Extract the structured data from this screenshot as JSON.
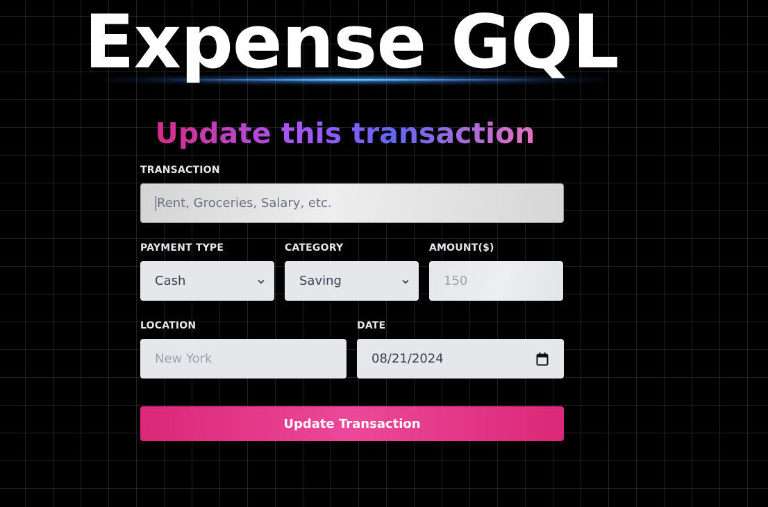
{
  "app": {
    "title": "Expense GQL"
  },
  "form": {
    "heading": "Update this transaction",
    "transaction": {
      "label": "TRANSACTION",
      "placeholder": "Rent, Groceries, Salary, etc.",
      "value": ""
    },
    "payment_type": {
      "label": "PAYMENT TYPE",
      "selected": "Cash"
    },
    "category": {
      "label": "CATEGORY",
      "selected": "Saving"
    },
    "amount": {
      "label": "AMOUNT($)",
      "placeholder": "150"
    },
    "location": {
      "label": "LOCATION",
      "placeholder": "New York"
    },
    "date": {
      "label": "DATE",
      "value": "08/21/2024"
    },
    "submit_label": "Update Transaction"
  },
  "colors": {
    "background": "#000000",
    "accent": "#ec4899",
    "field_background": "#e5e7eb"
  },
  "icons": {
    "select_chevron": "chevron-down-icon",
    "date_picker": "calendar-icon"
  }
}
